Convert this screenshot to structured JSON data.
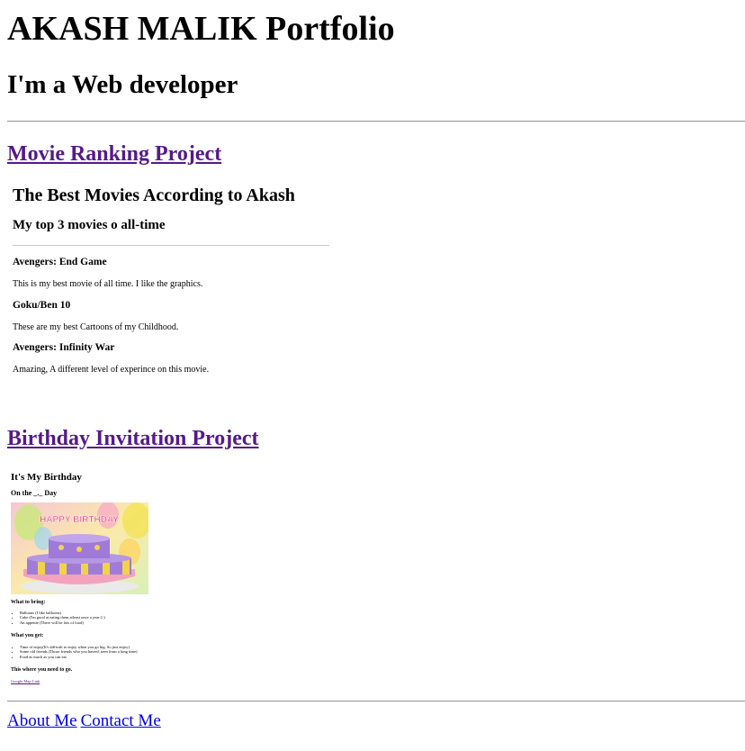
{
  "header": {
    "title": "AKASH MALIK Portfolio",
    "subtitle": "I'm a Web developer"
  },
  "projects": [
    {
      "link_label": "Movie Ranking Project",
      "frame": {
        "title": "The Best Movies According to Akash",
        "subtitle": "My top 3 movies o all-time",
        "movies": [
          {
            "name": "Avengers: End Game",
            "desc": "This is my best movie of all time. I like the graphics."
          },
          {
            "name": "Goku/Ben 10",
            "desc": "These are my best Cartoons of my Childhood."
          },
          {
            "name": "Avengers: Infinity War",
            "desc": "Amazing, A different level of experince on this movie."
          }
        ]
      }
    },
    {
      "link_label": "Birthday Invitation Project",
      "frame": {
        "title": "It's My Birthday",
        "date_line": "On the _._ Day",
        "bring_heading": "What to bring:",
        "bring_items": [
          "Balloons (I like balloons)",
          "Cake (I'm good at eating them  atleast once a year☺)",
          "An appetite (There will be lots of food)"
        ],
        "get_heading": "What you get:",
        "get_items": [
          "Time of enjoy(It's difficult to enjoy when you go big. So just enjoy)",
          "Some old friends (Those friends who you haven't seen from a long time)",
          "Food as much as you can eat"
        ],
        "where_heading": "This where you need to go.",
        "map_link": "Google Map Link",
        "image_text": "HAPPY BIRTHDAY"
      }
    }
  ],
  "footer": {
    "about": "About Me",
    "contact": "Contact Me"
  },
  "colors": {
    "visited_link": "#551a8b",
    "link": "#0000ee",
    "rule": "#9a9a9a"
  }
}
